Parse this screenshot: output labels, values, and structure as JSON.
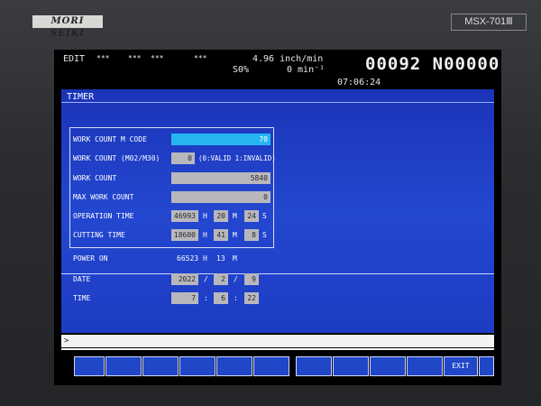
{
  "bezel": {
    "brand": "MORI SEIKI",
    "model": "MSX-701Ⅲ"
  },
  "status": {
    "mode": "EDIT",
    "flags": [
      "***",
      "***",
      "***",
      "***"
    ],
    "feed": "4.96 inch/min",
    "override": "S0%",
    "spindle": "0 min⁻¹",
    "program": "00092 N00000",
    "clock": "07:06:24"
  },
  "timer": {
    "title": "TIMER",
    "rows": {
      "work_count_m_code": {
        "label": "WORK COUNT M CODE",
        "value": "70"
      },
      "work_count_m02": {
        "label": "WORK COUNT (M02/M30)",
        "value": "0",
        "note": "(0:VALID 1:INVALID)"
      },
      "work_count": {
        "label": "WORK COUNT",
        "value": "5840"
      },
      "max_work_count": {
        "label": "MAX WORK COUNT",
        "value": "0"
      },
      "operation_time": {
        "label": "OPERATION TIME",
        "h": "46993",
        "m": "20",
        "s": "24"
      },
      "cutting_time": {
        "label": "CUTTING TIME",
        "h": "18600",
        "m": "41",
        "s": "8"
      },
      "power_on": {
        "label": "POWER ON",
        "h": "66523",
        "m": "13"
      },
      "date": {
        "label": "DATE",
        "y": "2022",
        "mo": "2",
        "d": "9"
      },
      "time": {
        "label": "TIME",
        "h": "7",
        "m": "6",
        "s": "22"
      }
    },
    "units": {
      "h": "H",
      "m": "M",
      "s": "S",
      "slash": "/",
      "colon": ":"
    }
  },
  "command": {
    "prompt": ">",
    "value": ""
  },
  "softkeys": [
    "",
    "",
    "",
    "",
    "",
    "",
    "",
    "",
    "",
    "",
    "EXIT",
    ""
  ]
}
